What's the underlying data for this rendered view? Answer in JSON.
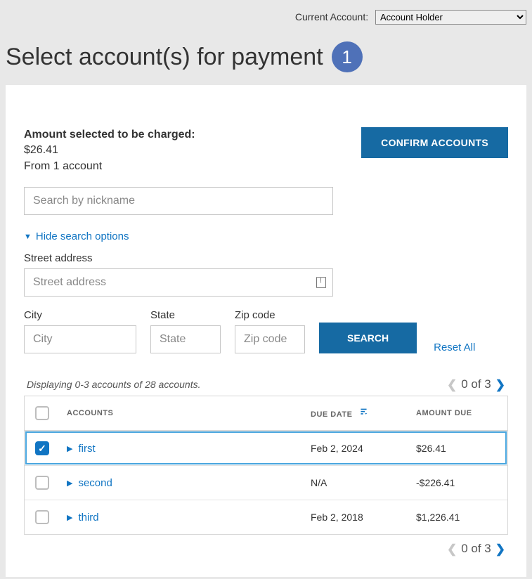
{
  "topbar": {
    "label": "Current Account:",
    "selected": "Account Holder"
  },
  "page_title": "Select account(s) for payment",
  "step": "1",
  "charge": {
    "label": "Amount selected to be charged:",
    "amount": "$26.41",
    "from": "From 1 account"
  },
  "confirm_btn": "CONFIRM ACCOUNTS",
  "search": {
    "nickname_placeholder": "Search by nickname",
    "toggle_label": "Hide search options",
    "street_label": "Street address",
    "street_placeholder": "Street address",
    "city_label": "City",
    "city_placeholder": "City",
    "state_label": "State",
    "state_placeholder": "State",
    "zip_label": "Zip code",
    "zip_placeholder": "Zip code",
    "search_btn": "SEARCH",
    "reset": "Reset All"
  },
  "list": {
    "summary": "Displaying 0-3 accounts of 28 accounts.",
    "pager_text": "0 of 3",
    "headers": {
      "accounts": "ACCOUNTS",
      "due": "DUE DATE",
      "amount": "AMOUNT DUE"
    },
    "rows": [
      {
        "checked": true,
        "name": "first",
        "due": "Feb 2, 2024",
        "amount": "$26.41"
      },
      {
        "checked": false,
        "name": "second",
        "due": "N/A",
        "amount": "-$226.41"
      },
      {
        "checked": false,
        "name": "third",
        "due": "Feb 2, 2018",
        "amount": "$1,226.41"
      }
    ]
  }
}
